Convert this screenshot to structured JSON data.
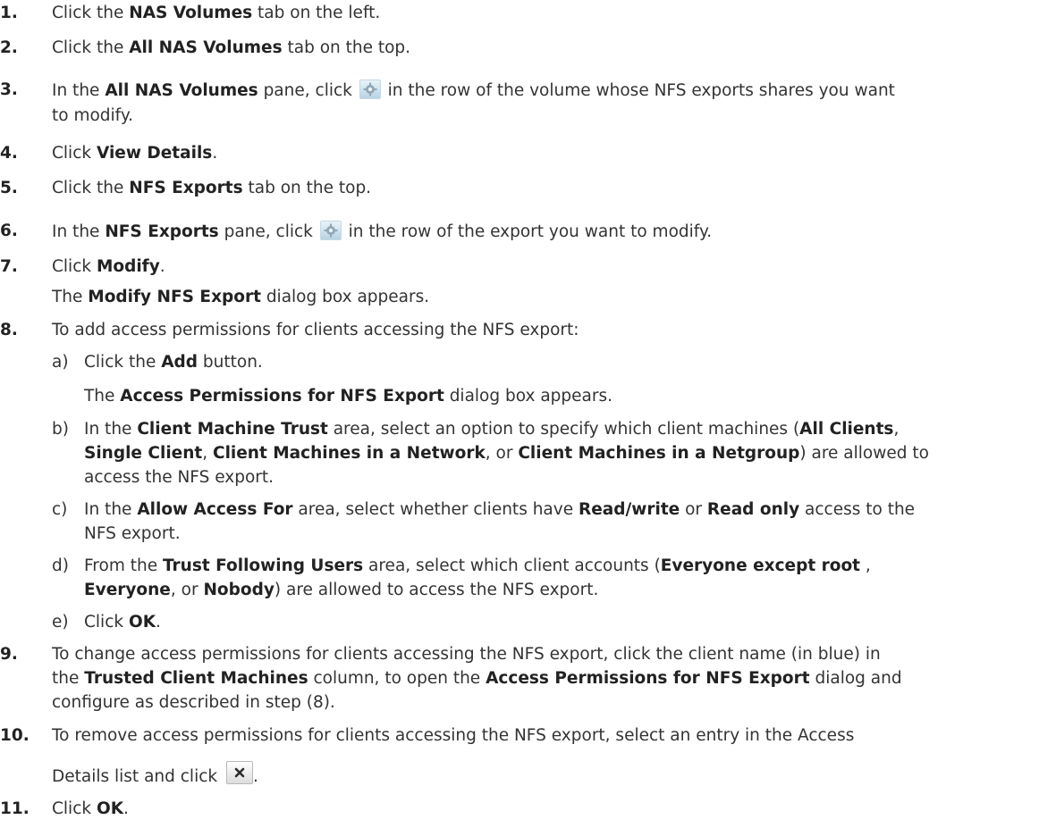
{
  "steps": [
    {
      "n": "1.",
      "a": "Click the ",
      "b1": "NAS Volumes",
      "c": " tab on the left."
    },
    {
      "n": "2.",
      "a": "Click the ",
      "b1": "All NAS Volumes",
      "c": " tab on the top."
    },
    {
      "n": "3.",
      "a": "In the ",
      "b1": "All NAS Volumes",
      "c": " pane, click ",
      "d": " in the row of the volume whose NFS exports shares you want",
      "e": "to modify."
    },
    {
      "n": "4.",
      "a": "Click ",
      "b1": "View Details",
      "c": "."
    },
    {
      "n": "5.",
      "a": "Click the ",
      "b1": "NFS Exports",
      "c": " tab on the top."
    },
    {
      "n": "6.",
      "a": "In the ",
      "b1": "NFS Exports",
      "c": " pane, click ",
      "d": " in the row of the export you want to modify."
    },
    {
      "n": "7.",
      "a": "Click ",
      "b1": "Modify",
      "c": ".",
      "r1": "The ",
      "r2": "Modify NFS Export",
      "r3": " dialog box appears."
    },
    {
      "n": "8.",
      "a": "To add access permissions for clients accessing the NFS export:"
    },
    {
      "n": "9.",
      "a": "To change access permissions for clients accessing the NFS export, click the client name (in blue) in",
      "l2a": "the ",
      "l2b": "Trusted Client Machines",
      "l2c": " column, to open the ",
      "l2d": "Access Permissions for NFS Export",
      "l2e": " dialog and",
      "l3": "configure as described in step (8)."
    },
    {
      "n": "10.",
      "a": "To remove access permissions for clients accessing the NFS export, select an entry in the Access",
      "l2": "Details list and click ",
      "l2end": "."
    },
    {
      "n": "11.",
      "a": "Click ",
      "b1": "OK",
      "c": "."
    }
  ],
  "substeps": [
    {
      "l": "a)",
      "a": "Click the ",
      "b1": "Add",
      "c": " button.",
      "r1": "The ",
      "r2": "Access Permissions for NFS Export",
      "r3": " dialog box appears."
    },
    {
      "l": "b)",
      "a": "In the ",
      "b1": "Client Machine Trust",
      "c": " area, select an option to specify which client machines (",
      "b2": "All Clients",
      "d": ",",
      "l2b1": "Single Client",
      "l2a": ", ",
      "l2b2": "Client Machines in a Network",
      "l2c": ", or ",
      "l2b3": "Client Machines in a Netgroup",
      "l2d": ") are allowed to",
      "l3": "access the NFS export."
    },
    {
      "l": "c)",
      "a": "In the ",
      "b1": "Allow Access For",
      "c": " area, select whether clients have ",
      "b2": "Read/write",
      "d": " or ",
      "b3": "Read only",
      "e": " access to the",
      "l2": "NFS export."
    },
    {
      "l": "d)",
      "a": "From the ",
      "b1": "Trust Following Users",
      "c": " area, select which client accounts (",
      "b2": "Everyone except root",
      "d": " ,",
      "l2b1": "Everyone",
      "l2a": ", or ",
      "l2b2": "Nobody",
      "l2c": ") are allowed to access the NFS export."
    },
    {
      "l": "e)",
      "a": "Click ",
      "b1": "OK",
      "c": "."
    }
  ],
  "icons": {
    "gear": "gear-icon",
    "delete": "close-icon"
  }
}
